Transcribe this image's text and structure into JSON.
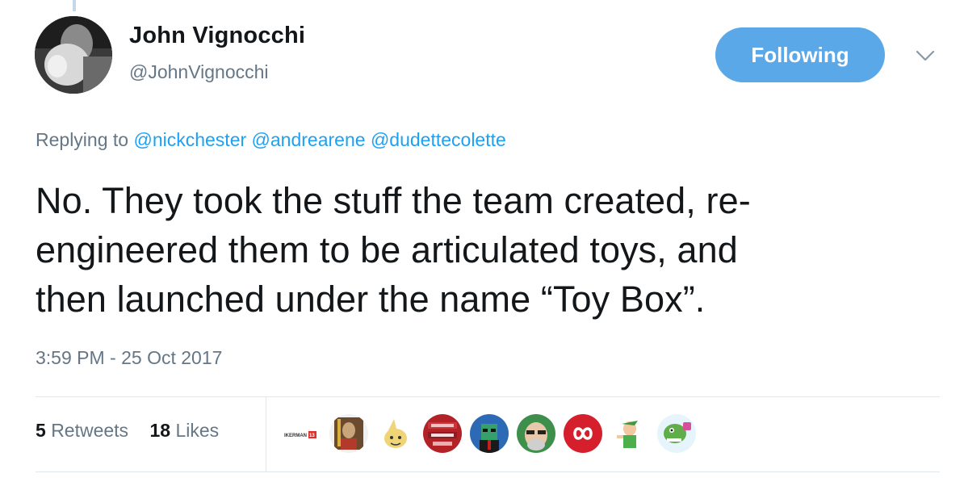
{
  "author": {
    "name": "John Vignocchi",
    "handle": "@JohnVignocchi"
  },
  "follow_button": {
    "label": "Following"
  },
  "reply_context": {
    "prefix": "Replying to",
    "mentions": [
      "@nickchester",
      "@andrearene",
      "@dudettecolette"
    ]
  },
  "tweet": {
    "lines": [
      "No. They took the stuff the team created, re-",
      "engineered them to be articulated toys, and",
      "then launched under the name “Toy Box”."
    ],
    "timestamp": "3:59 PM - 25 Oct 2017"
  },
  "stats": {
    "retweets_count": "5",
    "retweets_label": "Retweets",
    "likes_count": "18",
    "likes_label": "Likes"
  },
  "likers": {
    "first_avatar_text": "IKERMAN",
    "first_avatar_badge": "13"
  },
  "colors": {
    "accent": "#1da1f2",
    "button": "#5aa8e8",
    "muted": "#657786"
  },
  "icons": [
    "chevron-down-icon"
  ]
}
